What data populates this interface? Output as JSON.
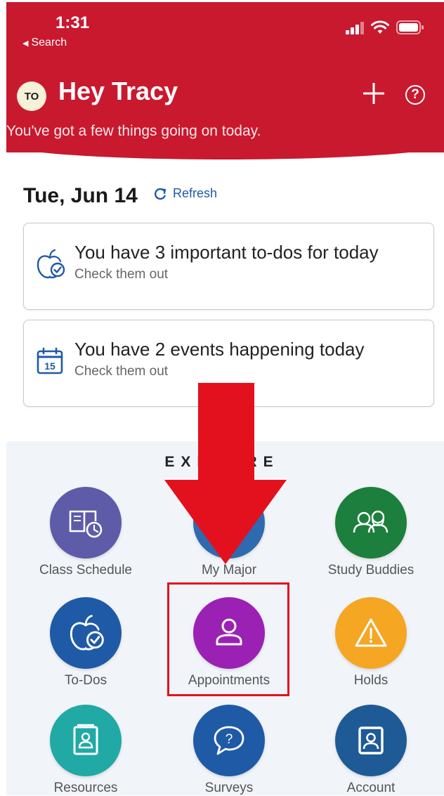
{
  "status_bar": {
    "time": "1:31",
    "back_label": "Search",
    "back_icon": "triangle-left-icon",
    "icons": [
      "signal-icon",
      "wifi-icon",
      "battery-icon"
    ]
  },
  "header": {
    "avatar_initials": "TO",
    "greeting": "Hey Tracy",
    "subtitle": "You've got a few things going on today.",
    "add_icon": "plus-icon",
    "help_icon": "question-circle-icon",
    "help_glyph": "?",
    "background_color": "#c8192f"
  },
  "date_row": {
    "date": "Tue, Jun 14",
    "refresh_label": "Refresh",
    "refresh_icon": "refresh-icon"
  },
  "cards": [
    {
      "title": "You have 3 important to-dos for today",
      "subtitle": "Check them out",
      "icon": "apple-check-icon"
    },
    {
      "title": "You have 2 events happening today",
      "subtitle": "Check them out",
      "icon": "calendar-icon",
      "icon_text": "15"
    }
  ],
  "explore": {
    "label": "EXPLORE",
    "tiles": [
      {
        "label": "Class Schedule",
        "icon": "book-clock-icon",
        "color": "#5e5ba8"
      },
      {
        "label": "My Major",
        "icon": "major-icon",
        "color": "#2f6ab0"
      },
      {
        "label": "Study Buddies",
        "icon": "people-icon",
        "color": "#1d7f3d"
      },
      {
        "label": "To-Dos",
        "icon": "apple-check-icon",
        "color": "#1f5aa6"
      },
      {
        "label": "Appointments",
        "icon": "person-icon",
        "color": "#9b21b5"
      },
      {
        "label": "Holds",
        "icon": "warning-icon",
        "color": "#f5a623"
      },
      {
        "label": "Resources",
        "icon": "contact-book-icon",
        "color": "#21a9a5"
      },
      {
        "label": "Surveys",
        "icon": "speech-question-icon",
        "color": "#1f5aa6",
        "icon_text": "?"
      },
      {
        "label": "Account",
        "icon": "account-portrait-icon",
        "color": "#1e5a96"
      }
    ]
  },
  "annotation": {
    "arrow_color": "#e3111d",
    "highlight_color": "#e2121f"
  }
}
